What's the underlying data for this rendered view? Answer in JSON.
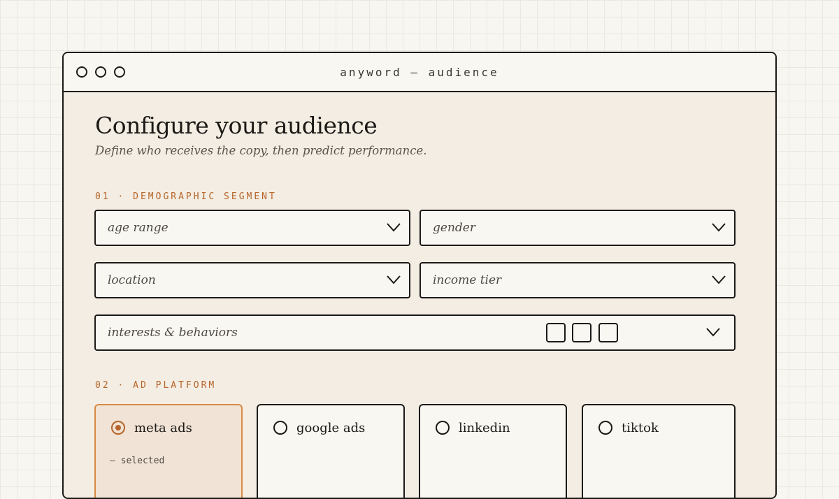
{
  "window": {
    "title": "anyword — audience",
    "controls": [
      "close",
      "minimize",
      "maximize"
    ]
  },
  "header": {
    "title": "Configure your audience",
    "subtitle": "Define who receives the copy, then predict performance."
  },
  "sections": {
    "demographic": {
      "label": "01 · DEMOGRAPHIC SEGMENT",
      "fields": {
        "age_range": "age range",
        "gender": "gender",
        "location": "location",
        "income_tier": "income tier",
        "interests": "interests & behaviors"
      }
    },
    "platform": {
      "label": "02 · AD PLATFORM",
      "options": [
        {
          "label": "meta ads",
          "selected": true,
          "note": "— selected"
        },
        {
          "label": "google ads",
          "selected": false
        },
        {
          "label": "linkedin",
          "selected": false
        },
        {
          "label": "tiktok",
          "selected": false
        }
      ]
    }
  },
  "icons": {
    "select": "chevron-down-icon",
    "radio_selected": "radio-checked-icon",
    "radio": "radio-unchecked-icon"
  },
  "colors": {
    "accent": "#b5652a",
    "selected_border": "#d88a45",
    "selected_fill": "#f1e3d5",
    "panel": "#f4ede3",
    "field": "#f9f7f2",
    "ink": "#1c1a17"
  }
}
